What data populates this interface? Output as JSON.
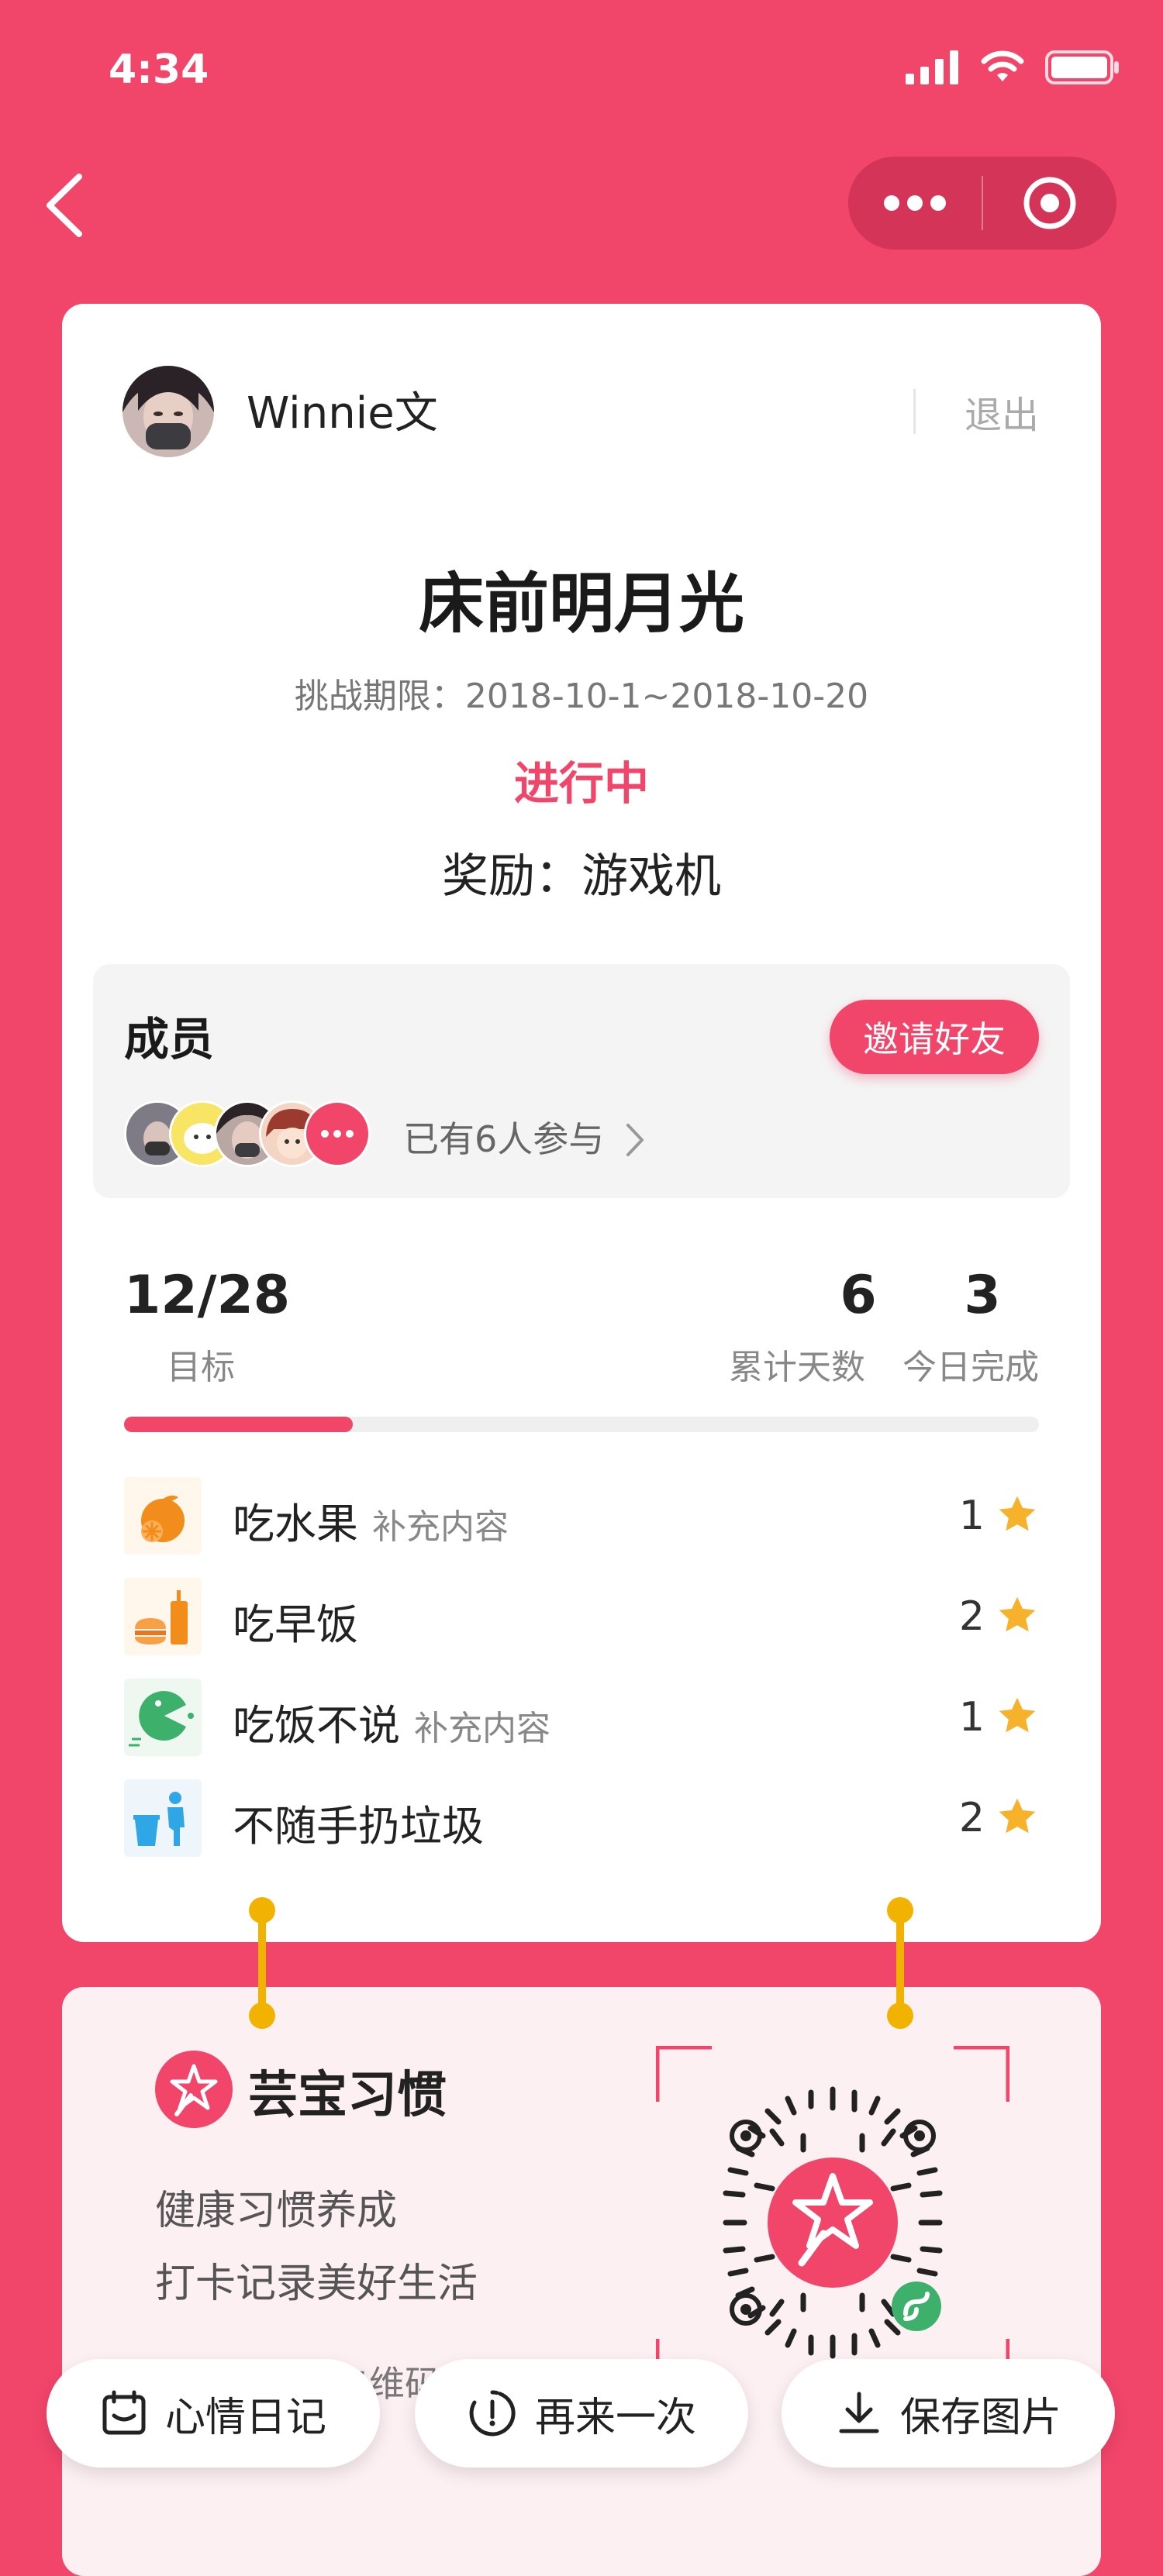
{
  "status_bar": {
    "time": "4:34"
  },
  "profile": {
    "username": "Winnie文",
    "logout_label": "退出"
  },
  "challenge": {
    "title": "床前明月光",
    "period": "挑战期限：2018-10-1~2018-10-20",
    "state": "进行中",
    "reward": "奖励：游戏机"
  },
  "members": {
    "title": "成员",
    "invite_label": "邀请好友",
    "joined_text": "已有6人参与"
  },
  "stats": {
    "goal_value": "12/28",
    "goal_label": "目标",
    "days_value": "6",
    "days_label": "累计天数",
    "today_value": "3",
    "today_label": "今日完成",
    "progress": 0.25
  },
  "tasks": [
    {
      "name": "吃水果",
      "note": "补充内容",
      "count": "1",
      "icon": "orange-icon"
    },
    {
      "name": "吃早饭",
      "note": "",
      "count": "2",
      "icon": "breakfast-icon"
    },
    {
      "name": "吃饭不说",
      "note": "补充内容",
      "count": "1",
      "icon": "pacman-icon"
    },
    {
      "name": "不随手扔垃圾",
      "note": "",
      "count": "2",
      "icon": "trash-person-icon"
    }
  ],
  "promo": {
    "brand": "芸宝习惯",
    "slogan_line1": "健康习惯养成",
    "slogan_line2": "打卡记录美好生活",
    "hint": "长按或扫描二维码进入小程序"
  },
  "bottom_bar": {
    "diary_label": "心情日记",
    "retry_label": "再来一次",
    "save_label": "保存图片"
  },
  "colors": {
    "primary": "#F2456A",
    "accent": "#F2B300",
    "star": "#F6B22A"
  }
}
